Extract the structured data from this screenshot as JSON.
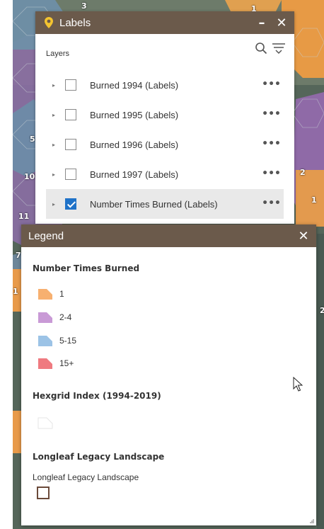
{
  "map": {
    "numbers": [
      "3",
      "1",
      "5",
      "10",
      "11",
      "2",
      "7",
      "1",
      "2",
      "1"
    ]
  },
  "labels_panel": {
    "title": "Labels",
    "minimize_icon": "minimize-icon",
    "close_icon": "close-icon",
    "layers_label": "Layers",
    "layers": [
      {
        "name": "Burned 1994 (Labels)",
        "checked": false
      },
      {
        "name": "Burned 1995 (Labels)",
        "checked": false
      },
      {
        "name": "Burned 1996 (Labels)",
        "checked": false
      },
      {
        "name": "Burned 1997 (Labels)",
        "checked": false
      },
      {
        "name": "Number Times Burned (Labels)",
        "checked": true
      }
    ],
    "more_label": "•••",
    "expand_label": "▸"
  },
  "legend_panel": {
    "title": "Legend",
    "sections": [
      {
        "title": "Number Times Burned",
        "items": [
          {
            "label": "1",
            "color": "#f7b070"
          },
          {
            "label": "2-4",
            "color": "#c99ad6"
          },
          {
            "label": "5-15",
            "color": "#9cc3e6"
          },
          {
            "label": "15+",
            "color": "#ef7a80"
          }
        ]
      },
      {
        "title": "Hexgrid Index (1994-2019)",
        "items": []
      },
      {
        "title": "Longleaf Legacy Landscape",
        "sublabel": "Longleaf Legacy Landscape"
      }
    ]
  },
  "colors": {
    "header": "#6b5a4b",
    "checkbox_checked": "#1f72c8"
  }
}
